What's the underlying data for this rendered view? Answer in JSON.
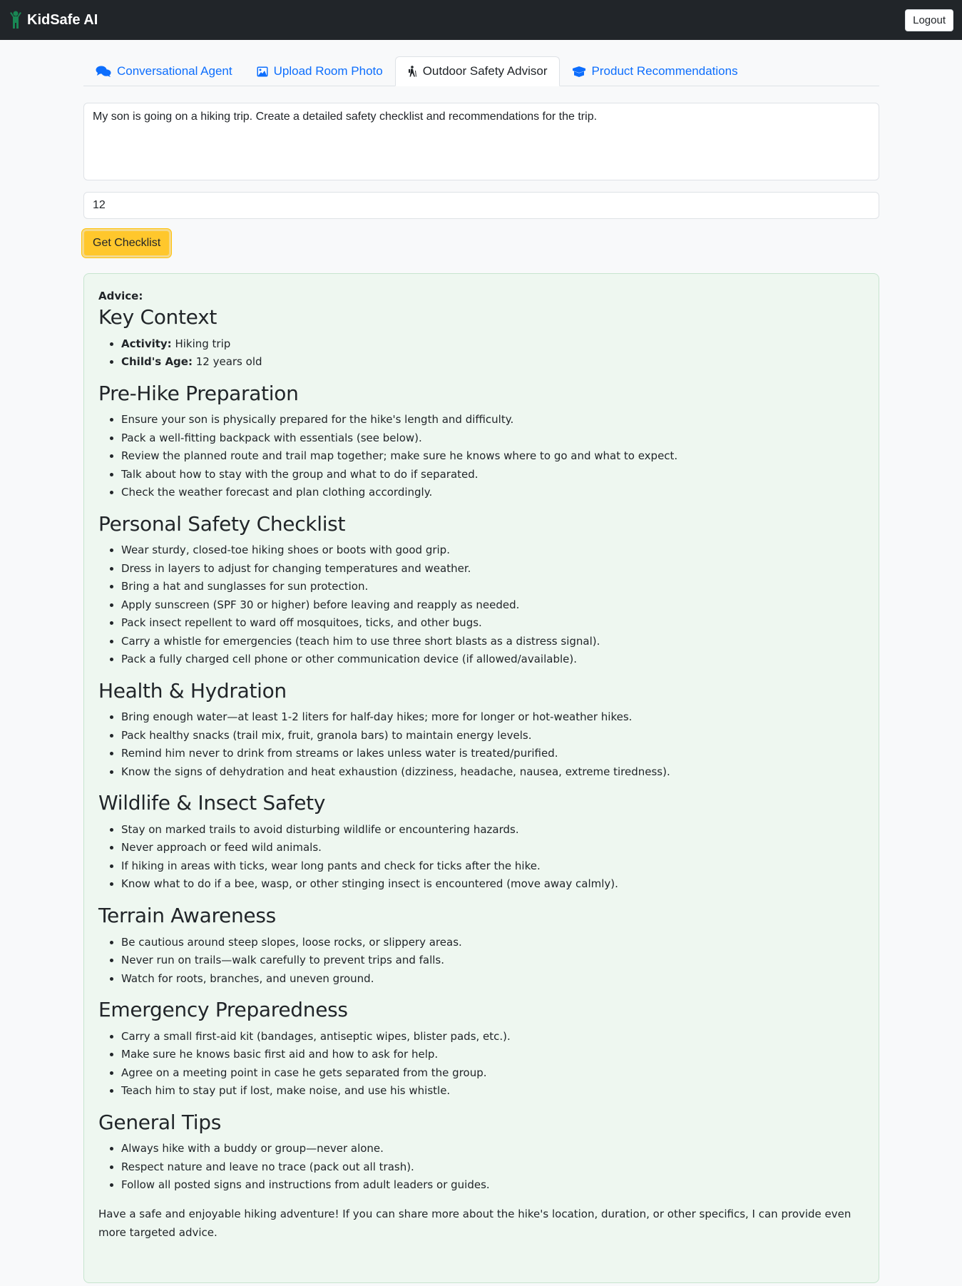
{
  "navbar": {
    "brand": "KidSafe AI",
    "logout_label": "Logout",
    "colors": {
      "background": "#212529",
      "brand_icon": "#198754"
    }
  },
  "tabs": [
    {
      "label": "Conversational Agent",
      "icon": "comments-icon",
      "active": false
    },
    {
      "label": "Upload Room Photo",
      "icon": "image-icon",
      "active": false
    },
    {
      "label": "Outdoor Safety Advisor",
      "icon": "hiking-icon",
      "active": true
    },
    {
      "label": "Product Recommendations",
      "icon": "boxes-icon",
      "active": false
    }
  ],
  "form": {
    "prompt_value": "My son is going on a hiking trip. Create a detailed safety checklist and recommendations for the trip.",
    "age_value": "12",
    "submit_label": "Get Checklist"
  },
  "advice": {
    "label": "Advice:",
    "key_context": {
      "title": "Key Context",
      "items": [
        {
          "key": "Activity:",
          "value": " Hiking trip"
        },
        {
          "key": "Child's Age:",
          "value": " 12 years old"
        }
      ]
    },
    "sections": [
      {
        "title": "Pre-Hike Preparation",
        "items": [
          "Ensure your son is physically prepared for the hike's length and difficulty.",
          "Pack a well-fitting backpack with essentials (see below).",
          "Review the planned route and trail map together; make sure he knows where to go and what to expect.",
          "Talk about how to stay with the group and what to do if separated.",
          "Check the weather forecast and plan clothing accordingly."
        ]
      },
      {
        "title": "Personal Safety Checklist",
        "items": [
          "Wear sturdy, closed-toe hiking shoes or boots with good grip.",
          "Dress in layers to adjust for changing temperatures and weather.",
          "Bring a hat and sunglasses for sun protection.",
          "Apply sunscreen (SPF 30 or higher) before leaving and reapply as needed.",
          "Pack insect repellent to ward off mosquitoes, ticks, and other bugs.",
          "Carry a whistle for emergencies (teach him to use three short blasts as a distress signal).",
          "Pack a fully charged cell phone or other communication device (if allowed/available)."
        ]
      },
      {
        "title": "Health & Hydration",
        "items": [
          "Bring enough water—at least 1-2 liters for half-day hikes; more for longer or hot-weather hikes.",
          "Pack healthy snacks (trail mix, fruit, granola bars) to maintain energy levels.",
          "Remind him never to drink from streams or lakes unless water is treated/purified.",
          "Know the signs of dehydration and heat exhaustion (dizziness, headache, nausea, extreme tiredness)."
        ]
      },
      {
        "title": "Wildlife & Insect Safety",
        "items": [
          "Stay on marked trails to avoid disturbing wildlife or encountering hazards.",
          "Never approach or feed wild animals.",
          "If hiking in areas with ticks, wear long pants and check for ticks after the hike.",
          "Know what to do if a bee, wasp, or other stinging insect is encountered (move away calmly)."
        ]
      },
      {
        "title": "Terrain Awareness",
        "items": [
          "Be cautious around steep slopes, loose rocks, or slippery areas.",
          "Never run on trails—walk carefully to prevent trips and falls.",
          "Watch for roots, branches, and uneven ground."
        ]
      },
      {
        "title": "Emergency Preparedness",
        "items": [
          "Carry a small first-aid kit (bandages, antiseptic wipes, blister pads, etc.).",
          "Make sure he knows basic first aid and how to ask for help.",
          "Agree on a meeting point in case he gets separated from the group.",
          "Teach him to stay put if lost, make noise, and use his whistle."
        ]
      },
      {
        "title": "General Tips",
        "items": [
          "Always hike with a buddy or group—never alone.",
          "Respect nature and leave no trace (pack out all trash).",
          "Follow all posted signs and instructions from adult leaders or guides."
        ]
      }
    ],
    "closing": "Have a safe and enjoyable hiking adventure! If you can share more about the hike's location, duration, or other specifics, I can provide even more targeted advice."
  }
}
